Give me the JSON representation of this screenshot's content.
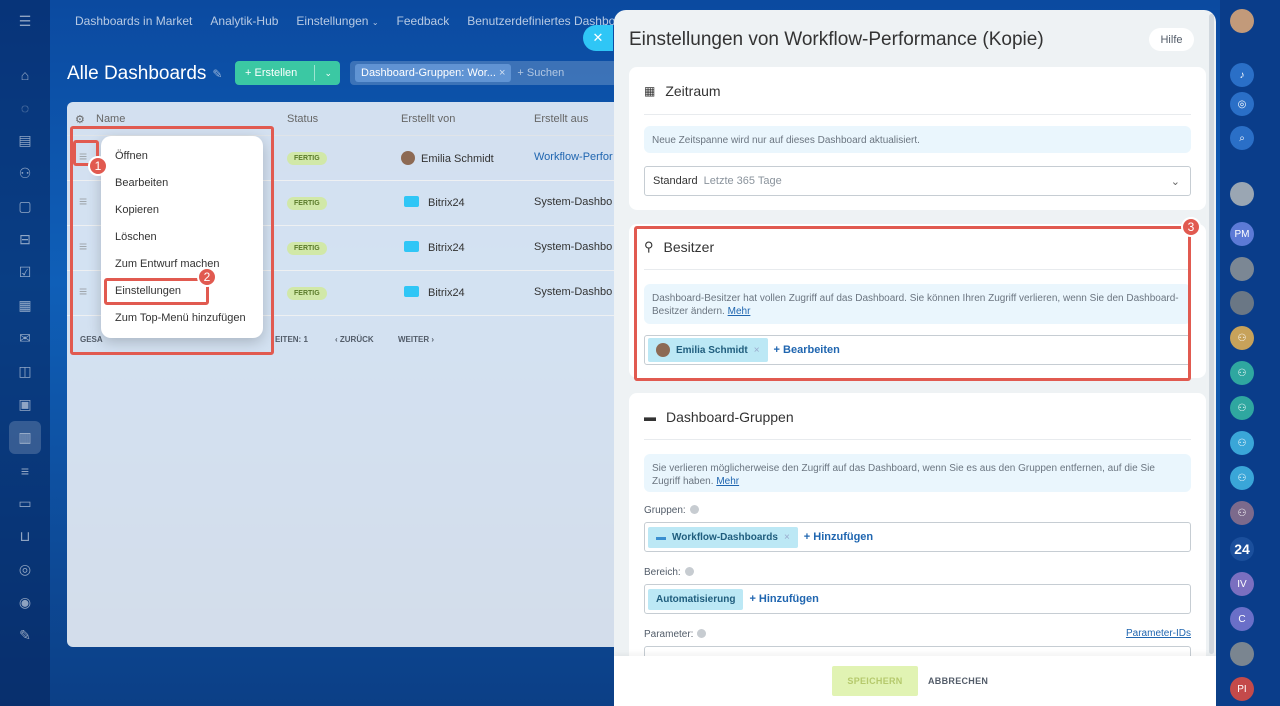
{
  "topnav": [
    "Dashboards in Market",
    "Analytik-Hub",
    "Einstellungen",
    "Feedback",
    "Benutzerdefiniertes Dashbo"
  ],
  "page": {
    "title": "Alle Dashboards",
    "create_label": "+ Erstellen",
    "filter_tag": "Dashboard-Gruppen: Wor...",
    "search_placeholder": "+ Suchen"
  },
  "grid": {
    "columns": [
      "Name",
      "Status",
      "Erstellt von",
      "Erstellt aus"
    ],
    "rows": [
      {
        "status": "FERTIG",
        "author": "Emilia Schmidt",
        "source": "Workflow-Perfor"
      },
      {
        "status": "FERTIG",
        "author": "Bitrix24",
        "source": "System-Dashbo"
      },
      {
        "status": "FERTIG",
        "author": "Bitrix24",
        "source": "System-Dashbo"
      },
      {
        "status": "FERTIG",
        "author": "Bitrix24",
        "source": "System-Dashbo"
      }
    ],
    "pager_total": "GESA",
    "pager_pages": "EITEN: 1",
    "pager_back": "ZURÜCK",
    "pager_next": "WEITER"
  },
  "context_menu": [
    "Öffnen",
    "Bearbeiten",
    "Kopieren",
    "Löschen",
    "Zum Entwurf machen",
    "Einstellungen",
    "Zum Top-Menü hinzufügen"
  ],
  "markers": [
    "1",
    "2",
    "3"
  ],
  "slider": {
    "title": "Einstellungen von Workflow-Performance (Kopie)",
    "help": "Hilfe",
    "period": {
      "heading": "Zeitraum",
      "info": "Neue Zeitspanne wird nur auf dieses Dashboard aktualisiert.",
      "select_value": "Standard",
      "select_hint": "Letzte 365 Tage"
    },
    "owner": {
      "heading": "Besitzer",
      "info": "Dashboard-Besitzer hat vollen Zugriff auf das Dashboard. Sie können Ihren Zugriff verlieren, wenn Sie den Dashboard-Besitzer ändern.",
      "more": "Mehr",
      "owner_name": "Emilia Schmidt",
      "edit": "+ Bearbeiten"
    },
    "groups": {
      "heading": "Dashboard-Gruppen",
      "info": "Sie verlieren möglicherweise den Zugriff auf das Dashboard, wenn Sie es aus den Gruppen entfernen, auf die Sie Zugriff haben.",
      "more": "Mehr",
      "groups_label": "Gruppen:",
      "group_chip": "Workflow-Dashboards",
      "add": "+ Hinzufügen",
      "scope_label": "Bereich:",
      "scope_chip": "Automatisierung",
      "params_label": "Parameter:",
      "params_link": "Parameter-IDs"
    },
    "save": "SPEICHERN",
    "cancel": "ABBRECHEN"
  },
  "rightbar": {
    "counter": "24",
    "initials": [
      "PM",
      "IV",
      "C",
      "PI"
    ]
  }
}
